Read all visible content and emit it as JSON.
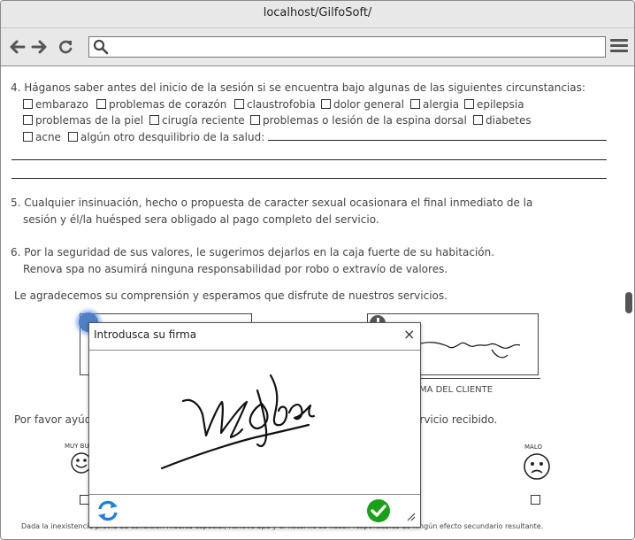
{
  "browser": {
    "url": "localhost/GilfoSoft/",
    "back_icon": "arrow-left-icon",
    "forward_icon": "arrow-right-icon",
    "reload_icon": "reload-icon",
    "search_icon": "search-icon",
    "menu_icon": "hamburger-menu-icon"
  },
  "document": {
    "q4": {
      "text": "4. Háganos saber antes del inicio de la sesión si se encuentra bajo algunas de las siguientes circunstancias:",
      "options": [
        "embarazo",
        "problemas de corazón",
        "claustrofobia",
        "dolor general",
        "alergia",
        "epilepsia",
        "problemas de la piel",
        "cirugía reciente",
        "problemas o lesión de la espina dorsal",
        "diabetes",
        "acne",
        "algún otro desquilibrio de la salud:"
      ]
    },
    "q5": {
      "line1": "5. Cualquier insinuación, hecho o propuesta de caracter sexual ocasionara el final inmediato de la",
      "line2": "sesión y él/la huésped sera obligado al pago completo del servicio."
    },
    "q6": {
      "line1": "6. Por la seguridad de sus valores, le sugerimos dejarlos en la caja fuerte de su habitación.",
      "line2": "Renova spa no asumirá ninguna responsabilidad por robo o extravío de valores."
    },
    "thanks": "Le agradecemos su comprensión y esperamos que disfrute de nuestros servicios.",
    "client_signature_label": "RMA DEL CLIENTE",
    "rating_prompt_left": "Por favor ayúd",
    "rating_prompt_right": "ervicio recibido.",
    "face_good_label": "MUY BU",
    "face_bad_label": "MALO",
    "footer": "Dada la inexistencia previa de condición médica especial, Renova Spa y el hotel no se hacen responsables de ningún efecto secundario resultante."
  },
  "signature_modal": {
    "title": "Introdusca su firma",
    "close_label": "×",
    "signature_text": "M. Sofloron"
  },
  "colors": {
    "chrome": "#e8e8e8",
    "confirm_green": "#1aa11a",
    "refresh_blue": "#1f7fe0",
    "pin_blue": "#4f7fc6"
  }
}
